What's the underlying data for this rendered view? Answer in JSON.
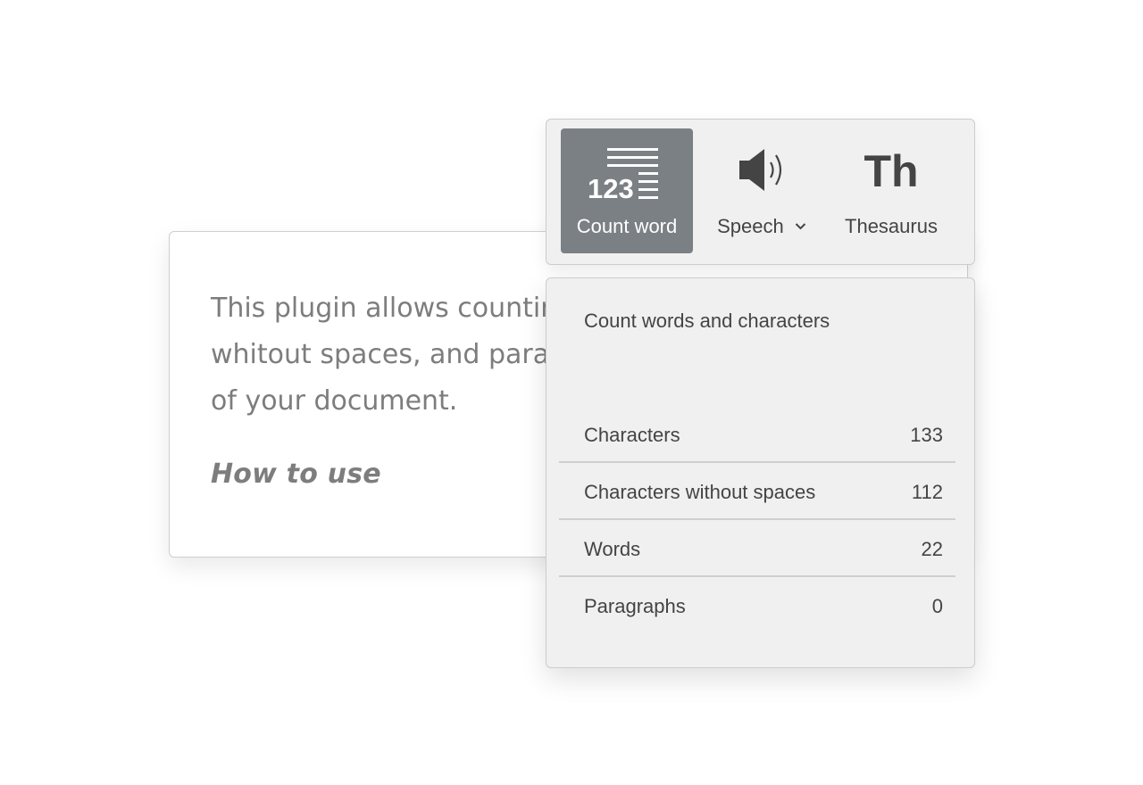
{
  "document": {
    "lines": [
      "This plugin allows countir",
      "whitout spaces, and para",
      "of your document."
    ],
    "heading": "How to use"
  },
  "toolbar": {
    "buttons": [
      {
        "label": "Count word",
        "icon": "count-word-icon",
        "active": true
      },
      {
        "label": "Speech",
        "icon": "speaker-icon",
        "has_dropdown": true
      },
      {
        "label": "Thesaurus",
        "icon": "thesaurus-icon",
        "icon_text": "Th"
      }
    ],
    "count_icon_text": "123"
  },
  "panel": {
    "title": "Count words and characters",
    "stats": [
      {
        "label": "Characters",
        "value": "133"
      },
      {
        "label": "Characters without spaces",
        "value": "112"
      },
      {
        "label": "Words",
        "value": "22"
      },
      {
        "label": "Paragraphs",
        "value": "0"
      }
    ]
  },
  "colors": {
    "active_button": "#7b8084",
    "panel_bg": "#f0f0f0",
    "text": "#444444",
    "document_text": "#7d7d7d"
  }
}
